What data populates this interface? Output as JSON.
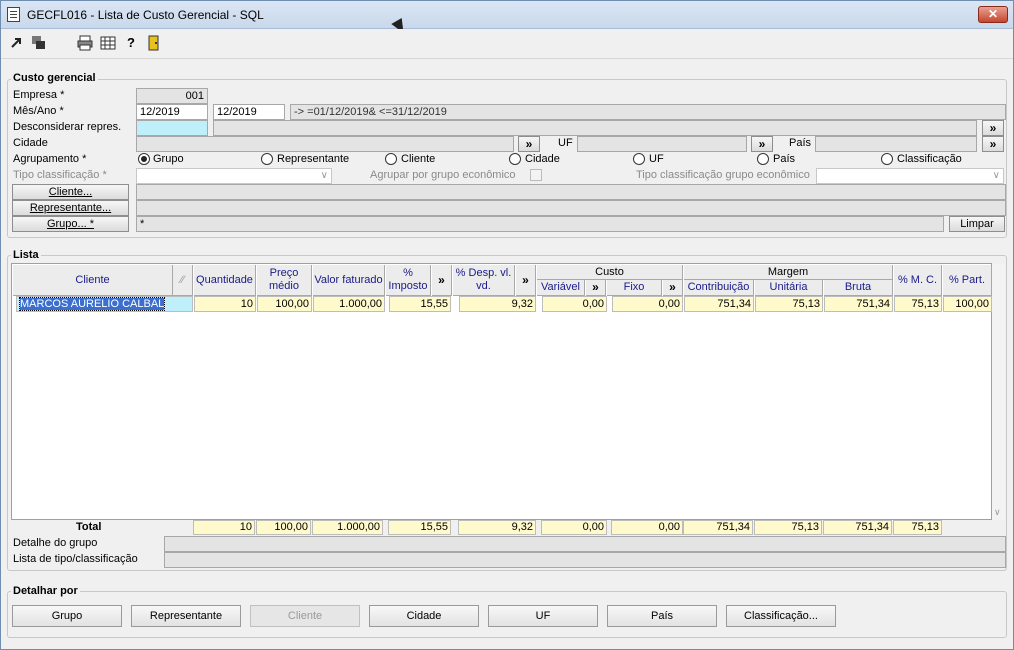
{
  "window": {
    "title": "GECFL016 - Lista de Custo Gerencial - SQL",
    "close_label": "✕"
  },
  "toolbar": {
    "icons": [
      "exit-icon",
      "copy-icon",
      "print-icon",
      "grid-icon",
      "help-icon",
      "door-icon"
    ]
  },
  "custo": {
    "legend": "Custo gerencial",
    "empresa_label": "Empresa *",
    "empresa_value": "001",
    "mesano_label": "Mês/Ano *",
    "mesano_from": "12/2019",
    "mesano_to": "12/2019",
    "mesano_expr": "-> =01/12/2019& <=31/12/2019",
    "desconsiderar_label": "Desconsiderar repres.",
    "cidade_label": "Cidade",
    "uf_label": "UF",
    "pais_label": "País",
    "agrupamento_label": "Agrupamento *",
    "agrupamento_options": [
      "Grupo",
      "Representante",
      "Cliente",
      "Cidade",
      "UF",
      "País",
      "Classificação"
    ],
    "tipo_class_label": "Tipo classificação *",
    "agrupar_label": "Agrupar por grupo econômico",
    "tipo_class_grupo_label": "Tipo classificação grupo econômico",
    "cliente_btn": "Cliente...",
    "representante_btn": "Representante...",
    "grupo_btn": "Grupo... *",
    "grupo_value": "*",
    "limpar_btn": "Limpar",
    "chevron": "»"
  },
  "lista": {
    "legend": "Lista",
    "headers": {
      "cliente": "Cliente",
      "quantidade": "Quantidade",
      "preco_medio": "Preço médio",
      "valor_faturado": "Valor faturado",
      "imposto": "% Imposto",
      "desp": "% Desp. vl. vd.",
      "custo": "Custo",
      "variavel": "Variável",
      "fixo": "Fixo",
      "margem": "Margem",
      "contribuicao": "Contribuição",
      "unitaria": "Unitária",
      "bruta": "Bruta",
      "mc": "% M. C.",
      "part": "% Part.",
      "chevron": "»"
    },
    "row": {
      "cliente": "MARCOS AURELIO CALBAL",
      "quantidade": "10",
      "preco_medio": "100,00",
      "valor_faturado": "1.000,00",
      "imposto": "15,55",
      "desp": "9,32",
      "variavel": "0,00",
      "fixo": "0,00",
      "contribuicao": "751,34",
      "unitaria": "75,13",
      "bruta": "751,34",
      "mc": "75,13",
      "part": "100,00"
    },
    "total_label": "Total",
    "total": {
      "quantidade": "10",
      "preco_medio": "100,00",
      "valor_faturado": "1.000,00",
      "imposto": "15,55",
      "desp": "9,32",
      "variavel": "0,00",
      "fixo": "0,00",
      "contribuicao": "751,34",
      "unitaria": "75,13",
      "bruta": "751,34",
      "mc": "75,13"
    },
    "detalhe_label": "Detalhe do grupo",
    "tipo_label": "Lista de tipo/classificação"
  },
  "detalhar": {
    "legend": "Detalhar por",
    "buttons": [
      "Grupo",
      "Representante",
      "Cliente",
      "Cidade",
      "UF",
      "País",
      "Classificação..."
    ]
  }
}
